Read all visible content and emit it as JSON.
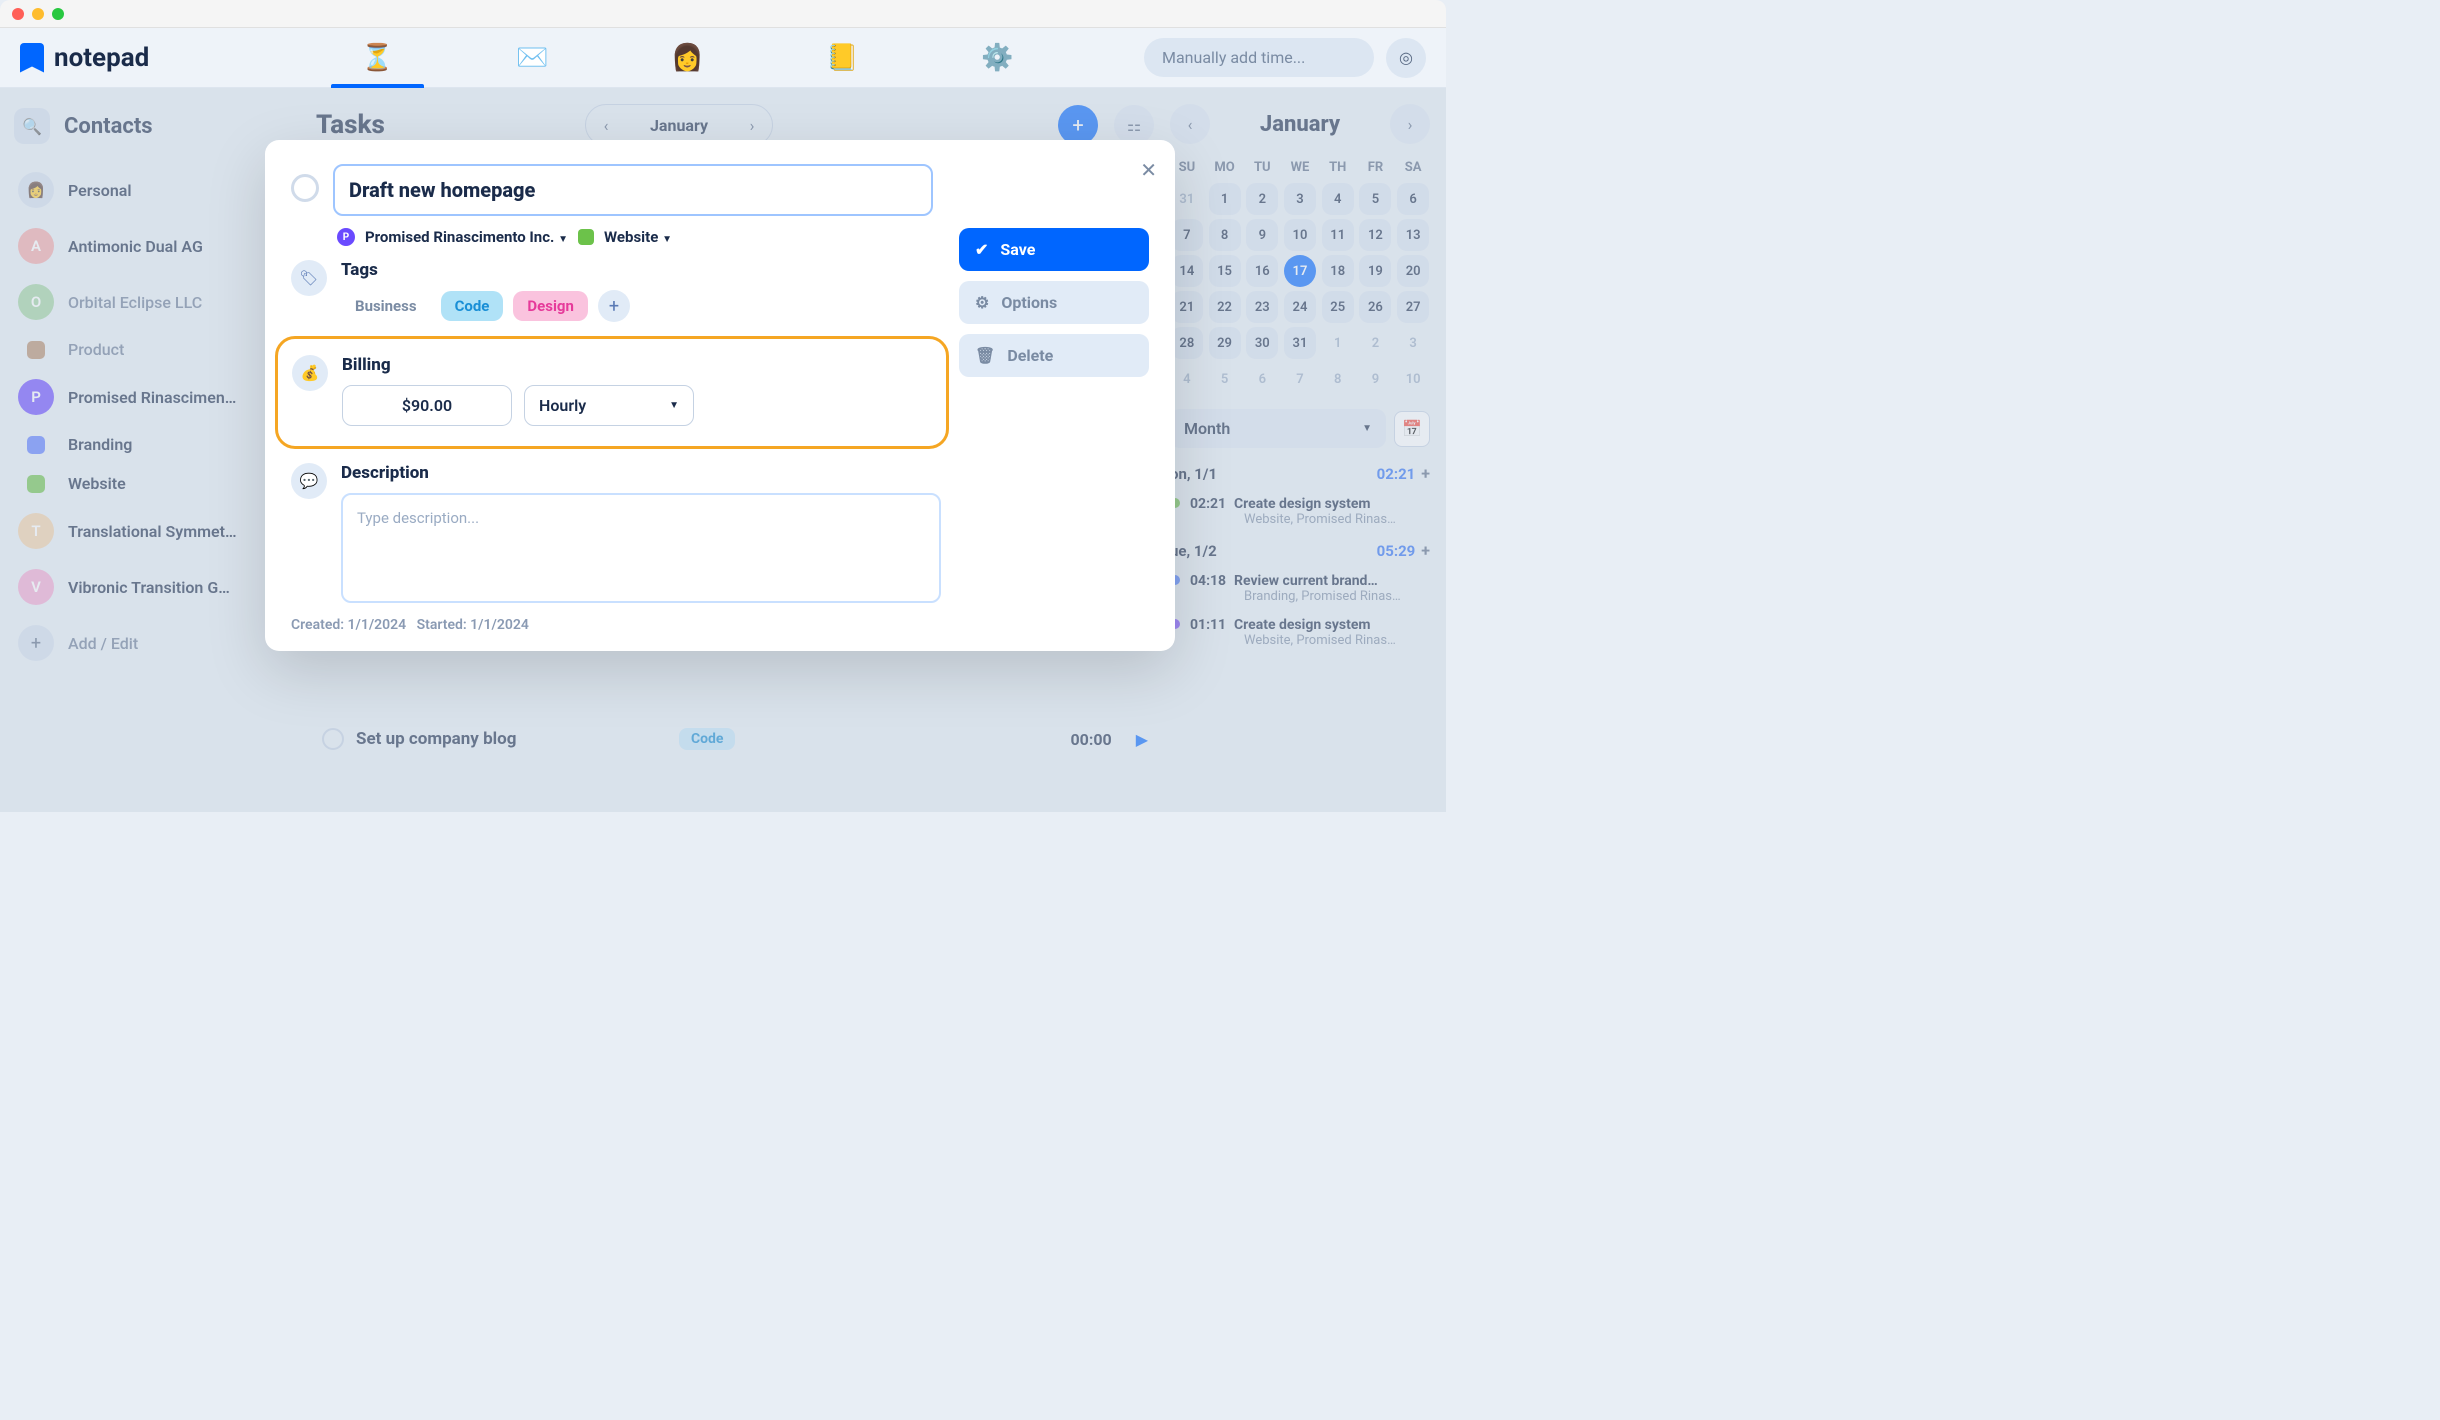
{
  "app_name": "notepad",
  "top_tabs": [
    "hourglass",
    "mail",
    "avatar",
    "book",
    "gear"
  ],
  "manual_time_placeholder": "Manually add time...",
  "sidebar": {
    "title": "Contacts",
    "items": [
      {
        "type": "personal",
        "label": "Personal"
      },
      {
        "type": "contact",
        "label": "Antimonic Dual AG",
        "color": "#f2a7a7",
        "initial": "A"
      },
      {
        "type": "contact",
        "label": "Orbital Eclipse LLC",
        "color": "#9ed29e",
        "initial": "O",
        "expandable": true
      },
      {
        "type": "project",
        "label": "Product",
        "color": "#b58a6b"
      },
      {
        "type": "contact",
        "label": "Promised Rinascimen…",
        "color": "#6a4aff",
        "initial": "P",
        "expandable": true,
        "active": true
      },
      {
        "type": "project",
        "label": "Branding",
        "color": "#5a7aff"
      },
      {
        "type": "project",
        "label": "Website",
        "color": "#6cc24a"
      },
      {
        "type": "contact",
        "label": "Translational Symmet…",
        "color": "#f2cfa7",
        "initial": "T"
      },
      {
        "type": "contact",
        "label": "Vibronic Transition G…",
        "color": "#f2a7cf",
        "initial": "V"
      }
    ],
    "add_label": "Add / Edit"
  },
  "tasks": {
    "title": "Tasks",
    "month": "January",
    "list": [
      {
        "name": "Set up company blog",
        "tag": "Code",
        "time": "00:00"
      }
    ]
  },
  "calendar": {
    "title": "January",
    "dow": [
      "SU",
      "MO",
      "TU",
      "WE",
      "TH",
      "FR",
      "SA"
    ],
    "days": [
      [
        31,
        1,
        2,
        3,
        4,
        5,
        6
      ],
      [
        7,
        8,
        9,
        10,
        11,
        12,
        13
      ],
      [
        14,
        15,
        16,
        17,
        18,
        19,
        20
      ],
      [
        21,
        22,
        23,
        24,
        25,
        26,
        27
      ],
      [
        28,
        29,
        30,
        31,
        1,
        2,
        3
      ],
      [
        4,
        5,
        6,
        7,
        8,
        9,
        10
      ]
    ],
    "selected_day": 17,
    "range_select_label": "Month"
  },
  "timeline": [
    {
      "day": "on, 1/1",
      "duration": "02:21",
      "entries": [
        {
          "dot": "green",
          "time": "02:21",
          "title": "Create design system",
          "sub": "Website, Promised Rinas…"
        }
      ]
    },
    {
      "day": "ue, 1/2",
      "duration": "05:29",
      "entries": [
        {
          "dot": "blue",
          "time": "04:18",
          "title": "Review current brand…",
          "sub": "Branding, Promised Rinas…"
        },
        {
          "dot": "purple",
          "time": "01:11",
          "title": "Create design system",
          "sub": "Website, Promised Rinas…"
        }
      ]
    }
  ],
  "modal": {
    "title_value": "Draft new homepage",
    "client": "Promised Rinascimento Inc.",
    "project": "Website",
    "tags_label": "Tags",
    "tags": [
      "Business",
      "Code",
      "Design"
    ],
    "billing_label": "Billing",
    "billing_amount": "$90.00",
    "billing_type": "Hourly",
    "description_label": "Description",
    "description_placeholder": "Type description...",
    "actions": {
      "save": "Save",
      "options": "Options",
      "delete": "Delete"
    },
    "created": "Created: 1/1/2024",
    "started": "Started: 1/1/2024"
  }
}
